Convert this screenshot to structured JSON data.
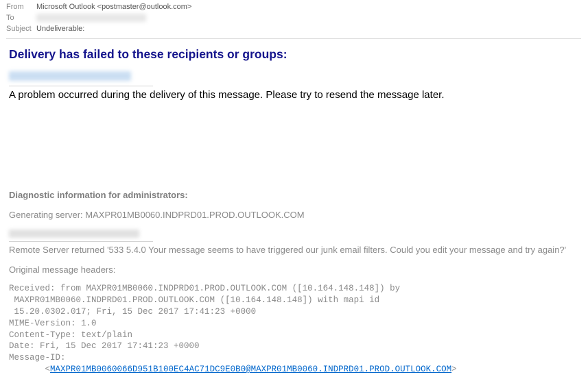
{
  "header": {
    "from_label": "From",
    "from_value": "Microsoft Outlook <postmaster@outlook.com>",
    "to_label": "To",
    "subject_label": "Subject",
    "subject_value": "Undeliverable:"
  },
  "body": {
    "fail_heading": "Delivery has failed to these recipients or groups:",
    "problem_text": "A problem occurred during the delivery of this message. Please try to resend the message later.",
    "diag_title": "Diagnostic information for administrators:",
    "gen_server_label": "Generating server: ",
    "gen_server_value": "MAXPR01MB0060.INDPRD01.PROD.OUTLOOK.COM",
    "remote_error": "Remote Server returned '533 5.4.0 Your message seems to have triggered our junk email filters. Could you edit your message and try again?'",
    "orig_headers_label": "Original message headers:",
    "headers_block": "Received: from MAXPR01MB0060.INDPRD01.PROD.OUTLOOK.COM ([10.164.148.148]) by\n MAXPR01MB0060.INDPRD01.PROD.OUTLOOK.COM ([10.164.148.148]) with mapi id\n 15.20.0302.017; Fri, 15 Dec 2017 17:41:23 +0000\nMIME-Version: 1.0\nContent-Type: text/plain\nDate: Fri, 15 Dec 2017 17:41:23 +0000\nMessage-ID:",
    "message_id": "MAXPR01MB0060066D951B100EC4AC71DC9E0B0@MAXPR01MB0060.INDPRD01.PROD.OUTLOOK.COM"
  }
}
